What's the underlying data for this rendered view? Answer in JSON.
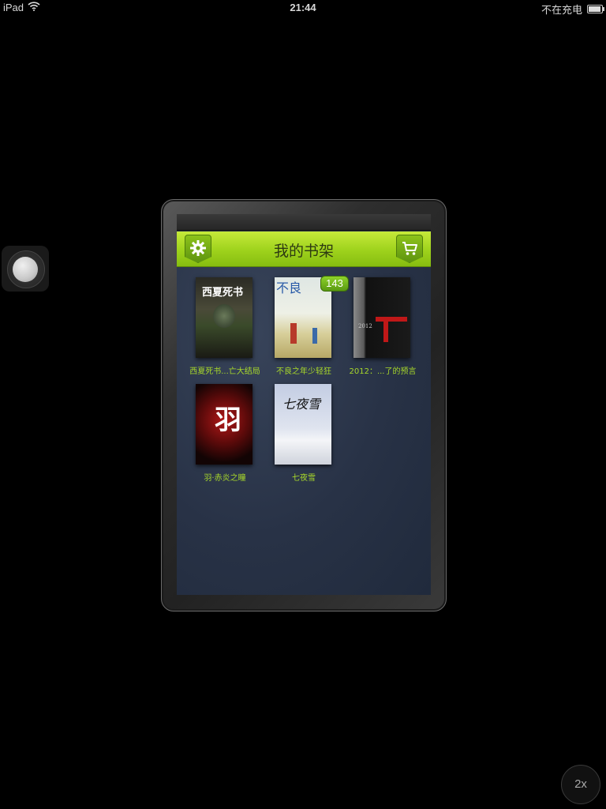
{
  "status_bar": {
    "device": "iPad",
    "time": "21:44",
    "charging_text": "不在充电"
  },
  "header": {
    "title": "我的书架",
    "settings_icon": "gear-icon",
    "store_icon": "cart-icon",
    "accent_color": "#a2d61f"
  },
  "books": [
    {
      "title": "西夏死书...亡大结局",
      "cover_text": "西夏死书",
      "badge": null
    },
    {
      "title": "不良之年少轻狂",
      "cover_text": "不良",
      "badge": "143"
    },
    {
      "title": "2012：...了的预言",
      "cover_text": "2012",
      "badge": null
    },
    {
      "title": "羽·赤炎之瞳",
      "cover_text": "羽",
      "badge": null
    },
    {
      "title": "七夜雪",
      "cover_text": "七夜雪",
      "badge": null
    }
  ],
  "zoom": {
    "label": "2x"
  }
}
